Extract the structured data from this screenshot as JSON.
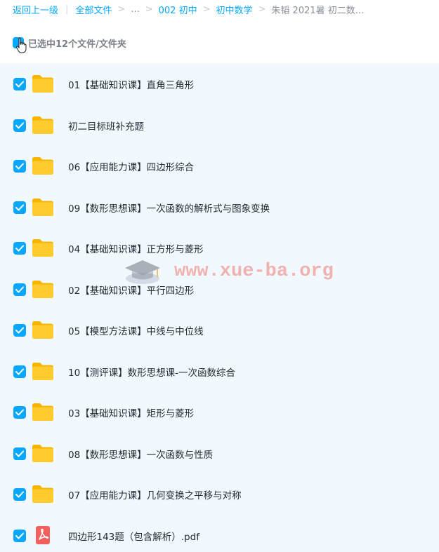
{
  "breadcrumb": {
    "back": "返回上一级",
    "all_files": "全部文件",
    "ellipsis": "...",
    "level1": "002 初中",
    "level2": "初中数学",
    "current": "朱韬 2021暑 初二数..."
  },
  "selection": {
    "text": "已选中12个文件/文件夹"
  },
  "watermark": "www.xue-ba.org",
  "files": [
    {
      "name": "01【基础知识课】直角三角形",
      "icon": "folder-icon",
      "checked": true
    },
    {
      "name": "初二目标班补充题",
      "icon": "folder-icon",
      "checked": true
    },
    {
      "name": "06【应用能力课】四边形综合",
      "icon": "folder-icon",
      "checked": true
    },
    {
      "name": "09【数形思想课】一次函数的解析式与图象变换",
      "icon": "folder-icon",
      "checked": true
    },
    {
      "name": "04【基础知识课】正方形与菱形",
      "icon": "folder-icon",
      "checked": true
    },
    {
      "name": "02【基础知识课】平行四边形",
      "icon": "folder-icon",
      "checked": true
    },
    {
      "name": "05【模型方法课】中线与中位线",
      "icon": "folder-icon",
      "checked": true
    },
    {
      "name": "10【测评课】数形思想课-一次函数综合",
      "icon": "folder-icon",
      "checked": true
    },
    {
      "name": "03【基础知识课】矩形与菱形",
      "icon": "folder-icon",
      "checked": true
    },
    {
      "name": "08【数形思想课】一次函数与性质",
      "icon": "folder-icon",
      "checked": true
    },
    {
      "name": "07【应用能力课】几何变换之平移与对称",
      "icon": "folder-icon",
      "checked": true
    },
    {
      "name": "四边形143题（包含解析）.pdf",
      "icon": "pdf-icon",
      "checked": true
    }
  ],
  "colors": {
    "accent": "#06a7ff",
    "list_background": "#f1f9ff",
    "folder": "#ffcb2f",
    "pdf": "#f25f5c"
  }
}
